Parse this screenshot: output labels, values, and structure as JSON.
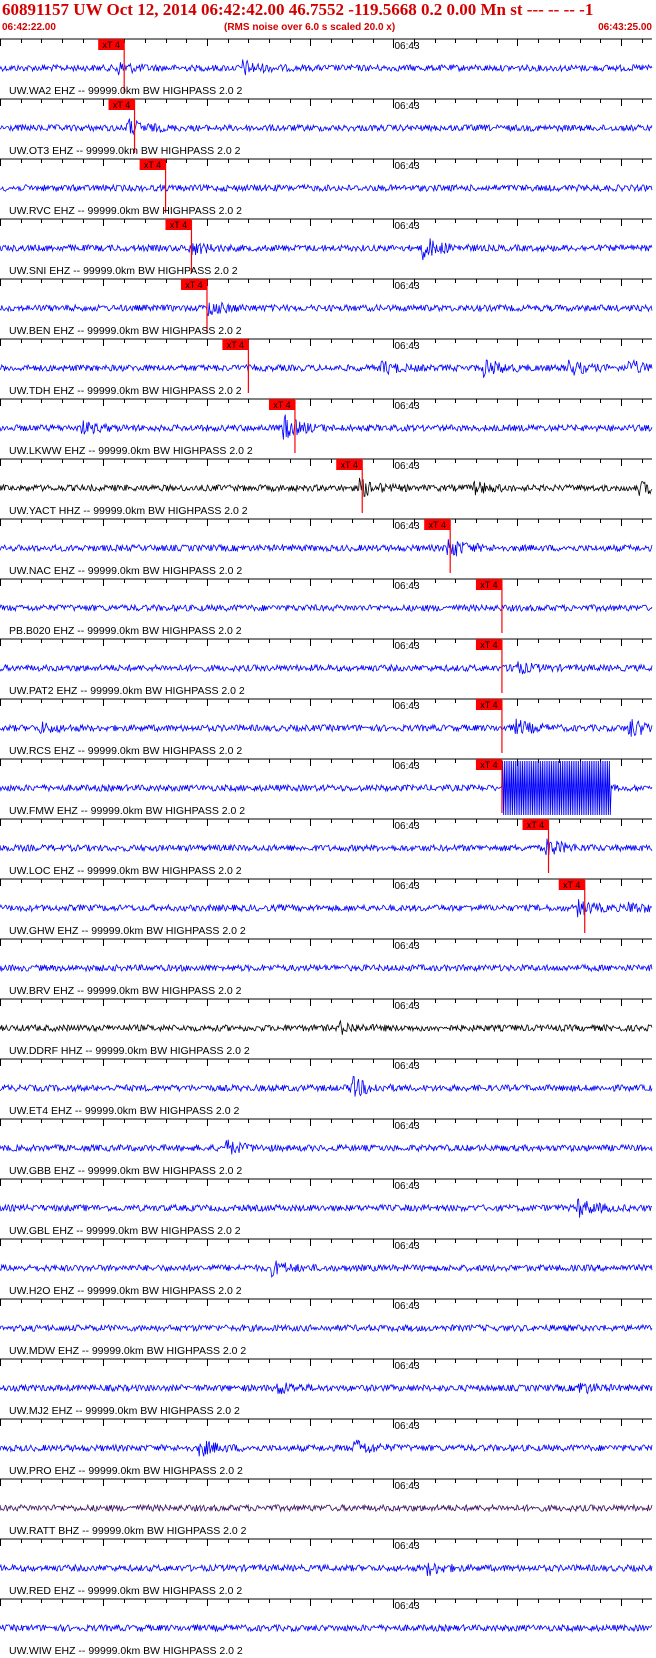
{
  "header": {
    "title": "60891157 UW Oct 12, 2014 06:42:42.00   46.7552 -119.5668  0.2 0.00 Mn st --- -- --  -1",
    "start_time": "06:42:22.00",
    "rms_note": "(RMS noise over 6.0 s scaled 20.0 x)",
    "end_time": "06:43:25.00"
  },
  "chart_data": {
    "type": "line",
    "title": "60891157 UW Oct 12, 2014 06:42:42.00   46.7552 -119.5668  0.2 0.00 Mn st --- -- --  -1",
    "x_start": "06:42:22.00",
    "x_end": "06:43:25.00",
    "x_range_s": [
      0,
      63
    ],
    "minute_label": "06:43",
    "minute_mark_s": 38,
    "tick_interval_s": 2,
    "grid": false,
    "colors": {
      "header": "#d40000",
      "trace_blue": "#0000ff",
      "trace_black": "#000000",
      "trace_dark": "#3a1060",
      "pick": "#ff0000"
    },
    "traces": [
      {
        "label": "UW.WA2 EHZ -- 99999.0km BW  HIGHPASS  2.0  2",
        "pick_label": "xT 4",
        "pick_s": 12.0,
        "color": "#0000ff",
        "events": [
          [
            11.5,
            1.6
          ],
          [
            23.5,
            2.0
          ]
        ]
      },
      {
        "label": "UW.OT3 EHZ -- 99999.0km BW  HIGHPASS  2.0  2",
        "pick_label": "xT 4",
        "pick_s": 13.0,
        "color": "#0000ff",
        "events": [
          [
            12.5,
            2.2
          ]
        ]
      },
      {
        "label": "UW.RVC EHZ -- 99999.0km BW  HIGHPASS  2.0  2",
        "pick_label": "xT 4",
        "pick_s": 16.0,
        "color": "#0000ff",
        "events": []
      },
      {
        "label": "UW.SNI EHZ -- 99999.0km BW  HIGHPASS  2.0  2",
        "pick_label": "xT 4",
        "pick_s": 18.5,
        "color": "#0000ff",
        "events": [
          [
            18.5,
            1.8
          ],
          [
            41.0,
            3.2
          ]
        ]
      },
      {
        "label": "UW.BEN EHZ -- 99999.0km BW  HIGHPASS  2.0  2",
        "pick_label": "xT 4",
        "pick_s": 20.0,
        "color": "#0000ff",
        "events": [
          [
            20.2,
            2.0
          ]
        ]
      },
      {
        "label": "UW.TDH EHZ -- 99999.0km BW  HIGHPASS  2.0  2",
        "pick_label": "xT 4",
        "pick_s": 24.0,
        "color": "#0000ff",
        "events": [
          [
            37.0,
            1.6
          ],
          [
            47.0,
            2.3
          ],
          [
            55.0,
            2.0
          ],
          [
            61.0,
            1.7
          ]
        ]
      },
      {
        "label": "UW.LKWW EHZ -- 99999.0km BW  HIGHPASS  2.0  2",
        "pick_label": "xT 4",
        "pick_s": 28.5,
        "color": "#0000ff",
        "events": [
          [
            8.0,
            1.6
          ],
          [
            27.5,
            3.4
          ]
        ]
      },
      {
        "label": "UW.YACT HHZ -- 99999.0km BW  HIGHPASS  2.0  2",
        "pick_label": "xT 4",
        "pick_s": 35.0,
        "color": "#000000",
        "events": [
          [
            35.0,
            2.2
          ],
          [
            46.0,
            1.5
          ],
          [
            62.0,
            1.5
          ]
        ]
      },
      {
        "label": "UW.NAC EHZ -- 99999.0km BW  HIGHPASS  2.0  2",
        "pick_label": "xT 4",
        "pick_s": 43.5,
        "color": "#0000ff",
        "events": [
          [
            43.5,
            2.8
          ]
        ]
      },
      {
        "label": "PB.B020 EHZ -- 99999.0km BW  HIGHPASS  2.0  2",
        "pick_label": "xT 4",
        "pick_s": 48.5,
        "color": "#0000ff",
        "events": []
      },
      {
        "label": "UW.PAT2 EHZ -- 99999.0km BW  HIGHPASS  2.0  2",
        "pick_label": "xT 4",
        "pick_s": 48.5,
        "color": "#0000ff",
        "events": [
          [
            49.5,
            2.0
          ]
        ]
      },
      {
        "label": "UW.RCS EHZ -- 99999.0km BW  HIGHPASS  2.0  2",
        "pick_label": "xT 4",
        "pick_s": 48.5,
        "color": "#0000ff",
        "events": [
          [
            4.0,
            1.3
          ],
          [
            50.0,
            2.0
          ],
          [
            61.0,
            2.5
          ]
        ]
      },
      {
        "label": "UW.FMW EHZ -- 99999.0km BW  HIGHPASS  2.0  2",
        "pick_label": "xT 4",
        "pick_s": 48.5,
        "color": "#0000ff",
        "events": [],
        "clipped": [
          48.5,
          59.0
        ]
      },
      {
        "label": "UW.LOC EHZ -- 99999.0km BW  HIGHPASS  2.0  2",
        "pick_label": "xT 4",
        "pick_s": 53.0,
        "color": "#0000ff",
        "events": [
          [
            53.0,
            2.4
          ]
        ]
      },
      {
        "label": "UW.GHW EHZ -- 99999.0km BW  HIGHPASS  2.0  2",
        "pick_label": "xT 4",
        "pick_s": 56.5,
        "color": "#0000ff",
        "events": [
          [
            56.0,
            2.0
          ],
          [
            61.0,
            1.4
          ]
        ]
      },
      {
        "label": "UW.BRV EHZ -- 99999.0km BW  HIGHPASS  2.0  2",
        "color": "#0000ff",
        "events": []
      },
      {
        "label": "UW.DDRF HHZ -- 99999.0km BW  HIGHPASS  2.0  2",
        "color": "#000000",
        "events": [
          [
            33.0,
            1.4
          ]
        ]
      },
      {
        "label": "UW.ET4 EHZ -- 99999.0km BW  HIGHPASS  2.0  2",
        "color": "#0000ff",
        "events": [
          [
            34.0,
            3.0
          ]
        ]
      },
      {
        "label": "UW.GBB EHZ -- 99999.0km BW  HIGHPASS  2.0  2",
        "color": "#0000ff",
        "events": [
          [
            22.0,
            1.8
          ]
        ]
      },
      {
        "label": "UW.GBL EHZ -- 99999.0km BW  HIGHPASS  2.0  2",
        "color": "#0000ff",
        "events": [
          [
            56.0,
            2.3
          ]
        ]
      },
      {
        "label": "UW.H2O EHZ -- 99999.0km BW  HIGHPASS  2.0  2",
        "color": "#0000ff",
        "events": [
          [
            26.5,
            1.8
          ]
        ]
      },
      {
        "label": "UW.MDW EHZ -- 99999.0km BW  HIGHPASS  2.0  2",
        "color": "#0000ff",
        "events": []
      },
      {
        "label": "UW.MJ2 EHZ -- 99999.0km BW  HIGHPASS  2.0  2",
        "color": "#0000ff",
        "events": [
          [
            27.0,
            1.5
          ],
          [
            56.0,
            1.5
          ]
        ]
      },
      {
        "label": "UW.PRO EHZ -- 99999.0km BW  HIGHPASS  2.0  2",
        "color": "#0000ff",
        "events": [
          [
            19.5,
            2.0
          ],
          [
            34.5,
            2.0
          ]
        ]
      },
      {
        "label": "UW.RATT BHZ -- 99999.0km BW  HIGHPASS  2.0  2",
        "color": "#3a1060",
        "events": []
      },
      {
        "label": "UW.RED EHZ -- 99999.0km BW  HIGHPASS  2.0  2",
        "color": "#0000ff",
        "events": [
          [
            41.5,
            1.6
          ]
        ]
      },
      {
        "label": "UW.WIW EHZ -- 99999.0km BW  HIGHPASS  2.0  2",
        "color": "#0000ff",
        "events": []
      }
    ]
  }
}
